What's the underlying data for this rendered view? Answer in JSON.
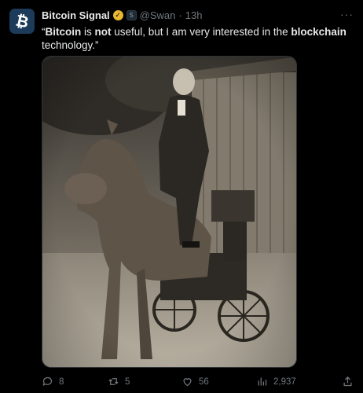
{
  "author": {
    "name": "Bitcoin Signal",
    "handle": "@Swan",
    "separator": "·",
    "time": "13h",
    "avatar_glyph": "₿",
    "verified_icon": "verified-badge-icon",
    "affiliate_icon": "swan-affiliate-icon"
  },
  "tweet": {
    "parts": [
      {
        "text": "“",
        "bold": false
      },
      {
        "text": "Bitcoin",
        "bold": true
      },
      {
        "text": " is ",
        "bold": false
      },
      {
        "text": "not",
        "bold": true
      },
      {
        "text": " useful, but I am very interested in the ",
        "bold": false
      },
      {
        "text": "blockchain",
        "bold": true
      },
      {
        "text": " technology.”",
        "bold": false
      }
    ]
  },
  "media": {
    "description_icon": "photo-man-on-mechanical-horse"
  },
  "actions": {
    "reply": {
      "count": "8",
      "icon": "reply-icon"
    },
    "retweet": {
      "count": "5",
      "icon": "retweet-icon"
    },
    "like": {
      "count": "56",
      "icon": "heart-icon"
    },
    "views": {
      "count": "2,937",
      "icon": "analytics-icon"
    },
    "share": {
      "icon": "share-icon"
    }
  },
  "colors": {
    "background": "#000000",
    "text": "#e7e9ea",
    "muted": "#71767b",
    "verified": "#e8b830"
  }
}
